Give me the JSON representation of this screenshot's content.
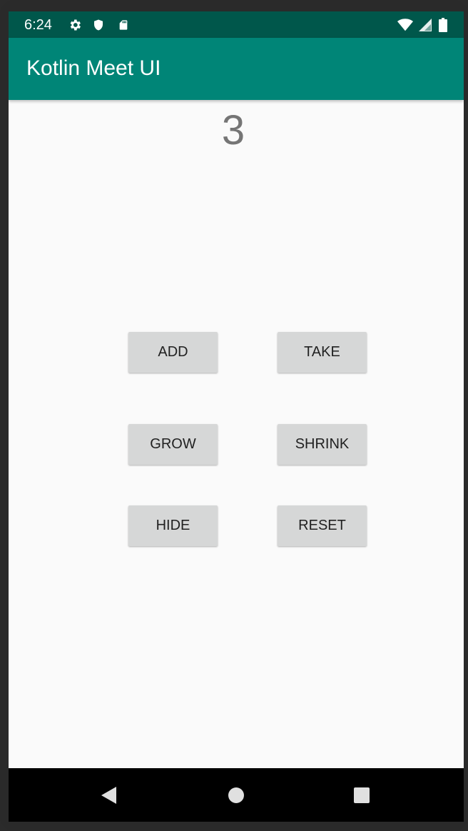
{
  "status_bar": {
    "time": "6:24",
    "icons": [
      "gear-icon",
      "shield-icon",
      "sd-card-icon",
      "wifi-icon",
      "signal-icon",
      "battery-icon"
    ]
  },
  "app_bar": {
    "title": "Kotlin Meet UI"
  },
  "main": {
    "counter_value": "3",
    "buttons": {
      "add": "ADD",
      "take": "TAKE",
      "grow": "GROW",
      "shrink": "SHRINK",
      "hide": "HIDE",
      "reset": "RESET"
    }
  },
  "nav_bar": {
    "icons": [
      "back-icon",
      "home-icon",
      "recents-icon"
    ]
  },
  "colors": {
    "status_bar": "#00574b",
    "app_bar": "#008577",
    "background": "#fafafa",
    "button": "#d6d7d7",
    "counter_text": "#757575"
  }
}
